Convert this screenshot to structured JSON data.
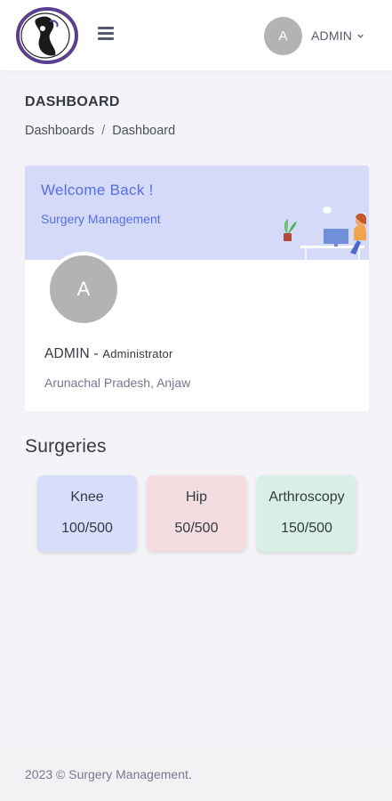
{
  "header": {
    "user_initial": "A",
    "user_name": "ADMIN"
  },
  "page": {
    "title": "DASHBOARD",
    "breadcrumb": [
      "Dashboards",
      "/",
      "Dashboard"
    ]
  },
  "welcome": {
    "title": "Welcome Back !",
    "subtitle": "Surgery Management",
    "avatar_initial": "A",
    "name": "ADMIN",
    "separator": " - ",
    "role": "Administrator",
    "location": "Arunachal Pradesh, Anjaw"
  },
  "surgeries": {
    "title": "Surgeries",
    "tiles": [
      {
        "name": "Knee",
        "count": "100/500",
        "color": "#d7defc"
      },
      {
        "name": "Hip",
        "count": "50/500",
        "color": "#f3dde0"
      },
      {
        "name": "Arthroscopy",
        "count": "150/500",
        "color": "#d8efe6"
      }
    ]
  },
  "footer": {
    "text": "2023 © Surgery Management."
  },
  "colors": {
    "accent": "#556ee6",
    "banner_bg": "#d5daf9",
    "avatar_bg": "#b3b3b3",
    "page_bg": "#f4f4f8"
  },
  "icons": {
    "logo": "orthopedic-logo-icon",
    "menu": "hamburger-menu-icon",
    "dropdown": "chevron-down-icon",
    "illustration": "desk-worker-illustration"
  }
}
